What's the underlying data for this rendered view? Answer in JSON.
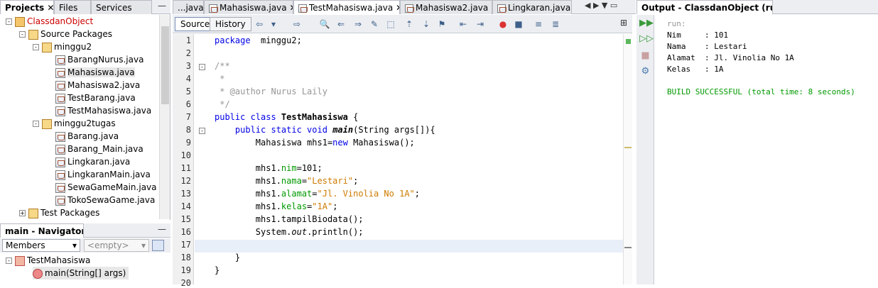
{
  "projects_panel": {
    "tabs": [
      "Projects",
      "Files",
      "Services"
    ],
    "tree": [
      {
        "label": "ClassdanObject",
        "type": "proj",
        "indent": 0,
        "exp": "-"
      },
      {
        "label": "Source Packages",
        "type": "pkg",
        "indent": 1,
        "exp": "-"
      },
      {
        "label": "minggu2",
        "type": "pkg",
        "indent": 2,
        "exp": "-"
      },
      {
        "label": "BarangNurus.java",
        "type": "java",
        "indent": 3
      },
      {
        "label": "Mahasiswa.java",
        "type": "java",
        "indent": 3
      },
      {
        "label": "Mahasiswa2.java",
        "type": "java",
        "indent": 3
      },
      {
        "label": "TestBarang.java",
        "type": "java",
        "indent": 3
      },
      {
        "label": "TestMahasiswa.java",
        "type": "java",
        "indent": 3
      },
      {
        "label": "minggu2tugas",
        "type": "pkg",
        "indent": 2,
        "exp": "-"
      },
      {
        "label": "Barang.java",
        "type": "java",
        "indent": 3
      },
      {
        "label": "Barang_Main.java",
        "type": "java",
        "indent": 3
      },
      {
        "label": "Lingkaran.java",
        "type": "java",
        "indent": 3
      },
      {
        "label": "LingkaranMain.java",
        "type": "java",
        "indent": 3
      },
      {
        "label": "SewaGameMain.java",
        "type": "java",
        "indent": 3
      },
      {
        "label": "TokoSewaGame.java",
        "type": "java",
        "indent": 3
      },
      {
        "label": "Test Packages",
        "type": "pkg",
        "indent": 1,
        "exp": "+"
      }
    ]
  },
  "navigator": {
    "title": "main - Navigator",
    "members_label": "Members",
    "filter_value": "<empty>",
    "class_name": "TestMahasiswa",
    "method_name": "main(String[] args)"
  },
  "editor": {
    "tabs": [
      "...java",
      "Mahasiswa.java",
      "TestMahasiswa.java",
      "Mahasiswa2.java",
      "Lingkaran.java..."
    ],
    "source_label": "Source",
    "history_label": "History",
    "lines": [
      {
        "n": "1",
        "parts": [
          [
            "kw",
            "package"
          ],
          [
            "",
            "  minggu2;"
          ]
        ]
      },
      {
        "n": "2",
        "parts": []
      },
      {
        "n": "3",
        "parts": [
          [
            "cm",
            "/**"
          ]
        ]
      },
      {
        "n": "4",
        "parts": [
          [
            "cm",
            " *"
          ]
        ]
      },
      {
        "n": "5",
        "parts": [
          [
            "cm",
            " * @author Nurus Laily"
          ]
        ]
      },
      {
        "n": "6",
        "parts": [
          [
            "cm",
            " */"
          ]
        ]
      },
      {
        "n": "7",
        "parts": [
          [
            "kw",
            "public class "
          ],
          [
            "bold",
            "TestMahasiswa"
          ],
          [
            "",
            " {"
          ]
        ]
      },
      {
        "n": "8",
        "parts": [
          [
            "",
            "    "
          ],
          [
            "kw",
            "public static void "
          ],
          [
            "bold it",
            "main"
          ],
          [
            "",
            "(String args[]){"
          ]
        ]
      },
      {
        "n": "9",
        "parts": [
          [
            "",
            "        Mahasiswa mhs1="
          ],
          [
            "kw",
            "new"
          ],
          [
            "",
            " Mahasiswa();"
          ]
        ]
      },
      {
        "n": "10",
        "parts": []
      },
      {
        "n": "11",
        "parts": [
          [
            "",
            "        mhs1."
          ],
          [
            "fd",
            "nim"
          ],
          [
            "",
            "=101;"
          ]
        ]
      },
      {
        "n": "12",
        "parts": [
          [
            "",
            "        mhs1."
          ],
          [
            "fd",
            "nama"
          ],
          [
            "",
            "="
          ],
          [
            "st",
            "\"Lestari\""
          ],
          [
            "",
            ";"
          ]
        ]
      },
      {
        "n": "13",
        "parts": [
          [
            "",
            "        mhs1."
          ],
          [
            "fd",
            "alamat"
          ],
          [
            "",
            "="
          ],
          [
            "st",
            "\"Jl. Vinolia No 1A\""
          ],
          [
            "",
            ";"
          ]
        ]
      },
      {
        "n": "14",
        "parts": [
          [
            "",
            "        mhs1."
          ],
          [
            "fd",
            "kelas"
          ],
          [
            "",
            "="
          ],
          [
            "st",
            "\"1A\""
          ],
          [
            "",
            ";"
          ]
        ]
      },
      {
        "n": "15",
        "parts": [
          [
            "",
            "        mhs1.tampilBiodata();"
          ]
        ]
      },
      {
        "n": "16",
        "parts": [
          [
            "",
            "        System."
          ],
          [
            "it",
            "out"
          ],
          [
            "",
            ".println();"
          ]
        ]
      },
      {
        "n": "17",
        "parts": []
      },
      {
        "n": "18",
        "parts": [
          [
            "",
            "    }"
          ]
        ]
      },
      {
        "n": "19",
        "parts": [
          [
            "",
            "}"
          ]
        ]
      },
      {
        "n": "20",
        "parts": []
      }
    ]
  },
  "output": {
    "title": "Output - ClassdanObject (run)",
    "lines": [
      {
        "text": "run:",
        "cls": "cm"
      },
      {
        "text": "Nim     : 101",
        "cls": ""
      },
      {
        "text": "Nama    : Lestari",
        "cls": ""
      },
      {
        "text": "Alamat  : Jl. Vinolia No 1A",
        "cls": ""
      },
      {
        "text": "Kelas   : 1A",
        "cls": ""
      },
      {
        "text": "",
        "cls": ""
      },
      {
        "text": "BUILD SUCCESSFUL (total time: 8 seconds)",
        "cls": "fd"
      }
    ]
  }
}
